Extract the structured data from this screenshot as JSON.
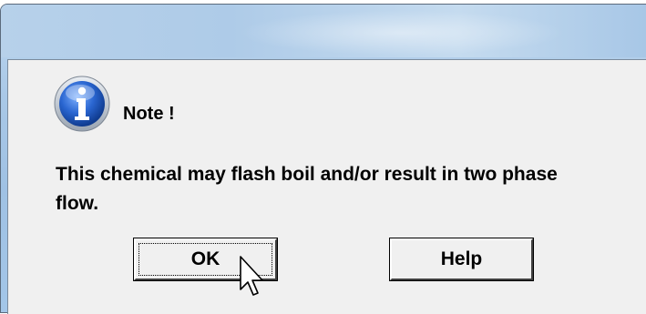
{
  "dialog": {
    "note_title": "Note !",
    "message": "This chemical may flash boil and/or result in two phase flow.",
    "icon": "info-icon"
  },
  "buttons": {
    "ok_label": "OK",
    "help_label": "Help"
  },
  "colors": {
    "titlebar": "#a9c8e7",
    "client_background": "#f0f0f0",
    "icon_blue": "#1e5bb8"
  }
}
